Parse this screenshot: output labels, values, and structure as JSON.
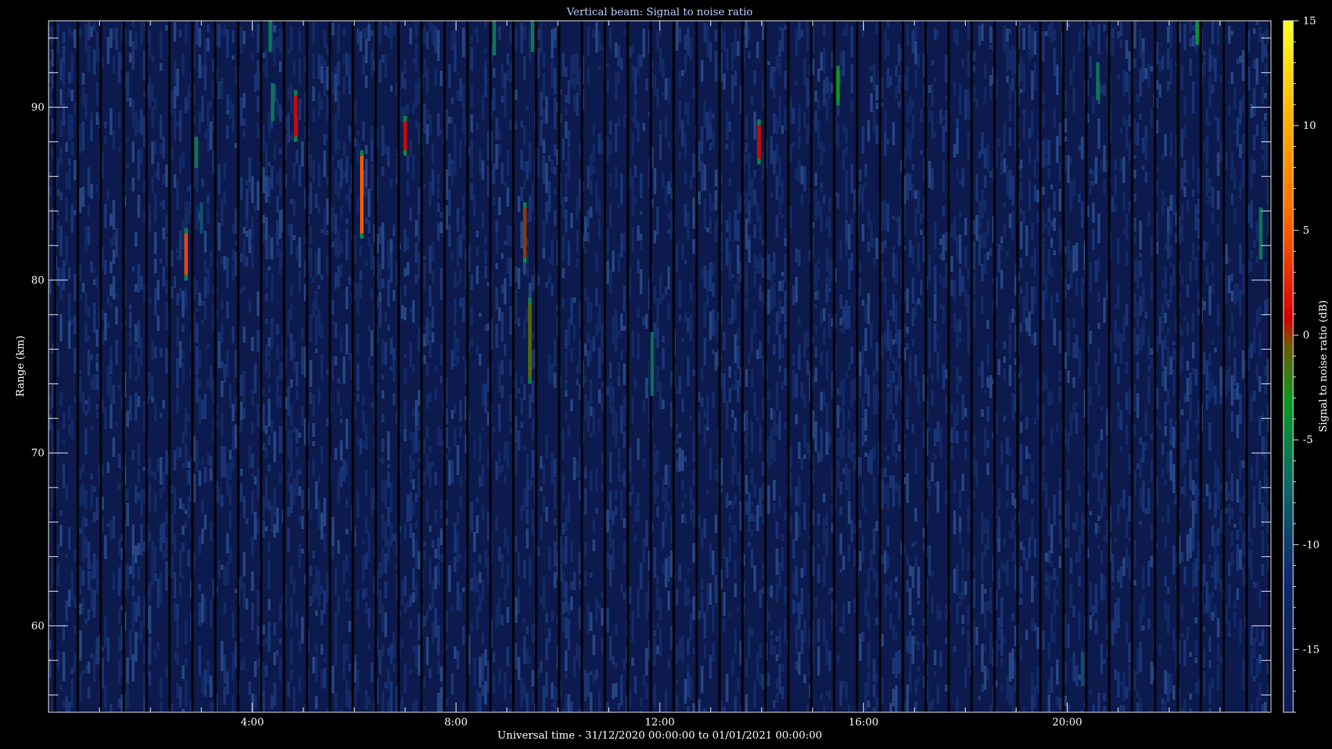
{
  "chart_data": {
    "type": "heatmap",
    "title": "Vertical beam: Signal to noise ratio",
    "xlabel": "Universal time - 31/12/2020 00:00:00 to 01/01/2021 00:00:00",
    "ylabel": "Range (km)",
    "colorbar_label": "Signal to noise ratio (dB)",
    "xlim_hours": [
      0,
      24
    ],
    "ylim_km": [
      55,
      95
    ],
    "clim_db": [
      -18,
      15
    ],
    "x_ticks": [
      {
        "value": 4,
        "label": "4:00"
      },
      {
        "value": 8,
        "label": "8:00"
      },
      {
        "value": 12,
        "label": "12:00"
      },
      {
        "value": 16,
        "label": "16:00"
      },
      {
        "value": 20,
        "label": "20:00"
      }
    ],
    "y_ticks": [
      {
        "value": 60,
        "label": "60"
      },
      {
        "value": 70,
        "label": "70"
      },
      {
        "value": 80,
        "label": "80"
      },
      {
        "value": 90,
        "label": "90"
      }
    ],
    "colorbar_ticks": [
      {
        "value": 15,
        "label": "15"
      },
      {
        "value": 10,
        "label": "10"
      },
      {
        "value": 5,
        "label": "5"
      },
      {
        "value": 0,
        "label": "0"
      },
      {
        "value": -5,
        "label": "-5"
      },
      {
        "value": -10,
        "label": "-10"
      },
      {
        "value": -15,
        "label": "-15"
      }
    ],
    "background_level_db": -16,
    "data_gaps_every_hours": 0.45,
    "echoes": [
      {
        "t": 2.7,
        "r_bottom": 80.0,
        "r_top": 83.0,
        "snr_db": 4
      },
      {
        "t": 2.9,
        "r_bottom": 86.5,
        "r_top": 88.3,
        "snr_db": -6
      },
      {
        "t": 3.0,
        "r_bottom": 82.7,
        "r_top": 84.5,
        "snr_db": -9
      },
      {
        "t": 4.35,
        "r_bottom": 93.2,
        "r_top": 95.0,
        "snr_db": -6
      },
      {
        "t": 4.4,
        "r_bottom": 89.2,
        "r_top": 91.4,
        "snr_db": -6
      },
      {
        "t": 4.85,
        "r_bottom": 88.0,
        "r_top": 91.0,
        "snr_db": 1
      },
      {
        "t": 6.15,
        "r_bottom": 82.4,
        "r_top": 87.5,
        "snr_db": 5
      },
      {
        "t": 7.0,
        "r_bottom": 87.2,
        "r_top": 89.5,
        "snr_db": 1
      },
      {
        "t": 8.75,
        "r_bottom": 93.0,
        "r_top": 95.0,
        "snr_db": -6
      },
      {
        "t": 9.35,
        "r_bottom": 81.0,
        "r_top": 84.5,
        "snr_db": 0
      },
      {
        "t": 9.45,
        "r_bottom": 74.0,
        "r_top": 79.0,
        "snr_db": -1
      },
      {
        "t": 9.5,
        "r_bottom": 93.2,
        "r_top": 95.0,
        "snr_db": -6
      },
      {
        "t": 11.85,
        "r_bottom": 73.3,
        "r_top": 77.0,
        "snr_db": -7
      },
      {
        "t": 13.95,
        "r_bottom": 86.7,
        "r_top": 89.3,
        "snr_db": 1
      },
      {
        "t": 15.5,
        "r_bottom": 90.1,
        "r_top": 92.4,
        "snr_db": -3
      },
      {
        "t": 20.3,
        "r_bottom": 56.5,
        "r_top": 58.5,
        "snr_db": -9
      },
      {
        "t": 20.6,
        "r_bottom": 90.4,
        "r_top": 92.6,
        "snr_db": -6
      },
      {
        "t": 22.55,
        "r_bottom": 93.6,
        "r_top": 95.0,
        "snr_db": -4
      },
      {
        "t": 23.8,
        "r_bottom": 81.2,
        "r_top": 84.2,
        "snr_db": -6
      }
    ]
  }
}
